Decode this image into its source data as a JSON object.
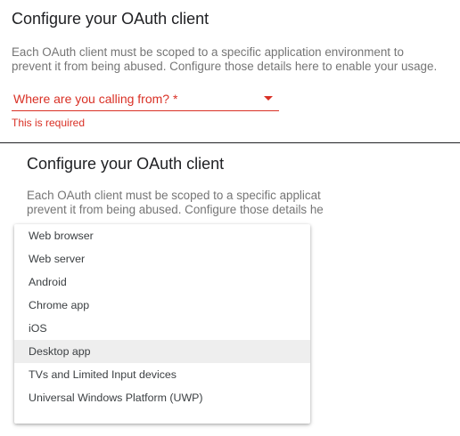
{
  "top_panel": {
    "title": "Configure your OAuth client",
    "description_line1": "Each OAuth client must be scoped to a specific application environment to",
    "description_line2": "prevent it from being abused. Configure those details here to enable your usage.",
    "select_label": "Where are you calling from? *",
    "error_text": "This is required"
  },
  "bottom_panel": {
    "title": "Configure your OAuth client",
    "description_line1": "Each OAuth client must be scoped to a specific applicat",
    "description_line2": "prevent it from being abused. Configure those details he",
    "menu_items": [
      {
        "label": "Web browser",
        "highlighted": false
      },
      {
        "label": "Web server",
        "highlighted": false
      },
      {
        "label": "Android",
        "highlighted": false
      },
      {
        "label": "Chrome app",
        "highlighted": false
      },
      {
        "label": "iOS",
        "highlighted": false
      },
      {
        "label": "Desktop app",
        "highlighted": true
      },
      {
        "label": "TVs and Limited Input devices",
        "highlighted": false
      },
      {
        "label": "Universal Windows Platform (UWP)",
        "highlighted": false
      }
    ]
  },
  "colors": {
    "error": "#d93025",
    "text": "#202124",
    "secondary_text": "#757575",
    "highlight": "#eeeeee"
  }
}
